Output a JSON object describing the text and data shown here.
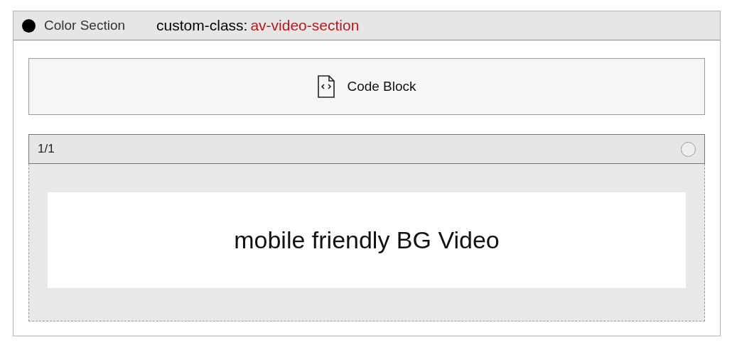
{
  "section": {
    "title": "Color Section",
    "class_label": "custom-class:",
    "class_value": "av-video-section"
  },
  "code_block": {
    "label": "Code Block"
  },
  "row": {
    "label": "1/1",
    "text": "mobile friendly BG Video"
  }
}
